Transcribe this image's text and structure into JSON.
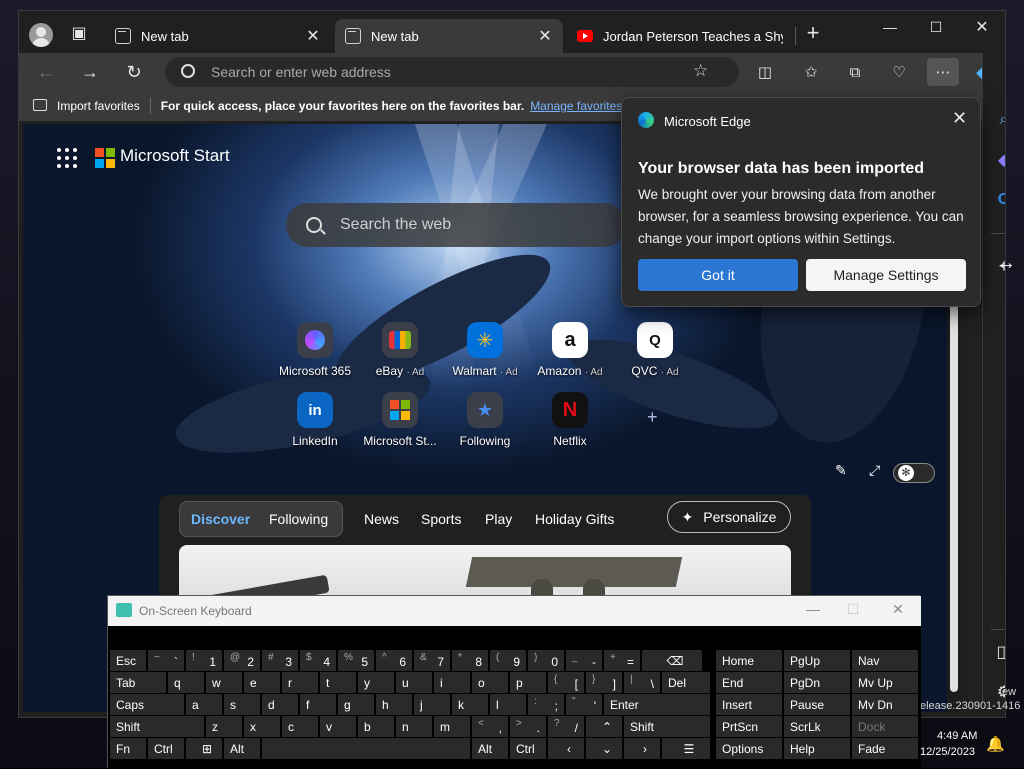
{
  "tabs": [
    {
      "title": "New tab"
    },
    {
      "title": "New tab"
    },
    {
      "title": "Jordan Peterson Teaches a Shy"
    }
  ],
  "address": {
    "placeholder": "Search or enter web address"
  },
  "favorites_bar": {
    "import_label": "Import favorites",
    "hint": "For quick access, place your favorites here on the favorites bar.",
    "manage_link": "Manage favorites"
  },
  "start_page": {
    "brand": "Microsoft Start",
    "search_placeholder": "Search the web",
    "quick_links": [
      {
        "label": "Microsoft 365",
        "ad": "",
        "icon": "microsoft-365-icon",
        "color": "#8a6cff"
      },
      {
        "label": "eBay",
        "ad": "· Ad",
        "icon": "ebay-icon",
        "color": "#e53238"
      },
      {
        "label": "Walmart",
        "ad": "· Ad",
        "icon": "walmart-icon",
        "color": "#0071dc"
      },
      {
        "label": "Amazon",
        "ad": "· Ad",
        "icon": "amazon-icon",
        "color": "#ffffff"
      },
      {
        "label": "QVC",
        "ad": "· Ad",
        "icon": "qvc-icon",
        "color": "#ffffff"
      },
      {
        "label": "LinkedIn",
        "ad": "",
        "icon": "linkedin-icon",
        "color": "#0a66c2"
      },
      {
        "label": "Microsoft St...",
        "ad": "",
        "icon": "microsoft-store-icon",
        "color": "#f25022"
      },
      {
        "label": "Following",
        "ad": "",
        "icon": "following-icon",
        "color": "#3b82f6"
      },
      {
        "label": "Netflix",
        "ad": "",
        "icon": "netflix-icon",
        "color": "#e50914"
      }
    ],
    "feed_tabs": [
      "Discover",
      "Following",
      "News",
      "Sports",
      "Play",
      "Holiday Gifts"
    ],
    "personalize": "Personalize"
  },
  "popup": {
    "app_name": "Microsoft Edge",
    "heading": "Your browser data has been imported",
    "body": "We brought over your browsing data from another browser, for a seamless browsing experience. You can change your import options within Settings.",
    "primary_button": "Got it",
    "secondary_button": "Manage Settings"
  },
  "keyboard": {
    "title": "On-Screen Keyboard",
    "row1": [
      {
        "s": "~",
        "m": "`"
      },
      {
        "s": "!",
        "m": "1"
      },
      {
        "s": "@",
        "m": "2"
      },
      {
        "s": "#",
        "m": "3"
      },
      {
        "s": "$",
        "m": "4"
      },
      {
        "s": "%",
        "m": "5"
      },
      {
        "s": "^",
        "m": "6"
      },
      {
        "s": "&",
        "m": "7"
      },
      {
        "s": "*",
        "m": "8"
      },
      {
        "s": "(",
        "m": "9"
      },
      {
        "s": ")",
        "m": "0"
      },
      {
        "s": "_",
        "m": "-"
      },
      {
        "s": "+",
        "m": "="
      }
    ],
    "row2": [
      "q",
      "w",
      "e",
      "r",
      "t",
      "y",
      "u",
      "i",
      "o",
      "p"
    ],
    "row2_brackets": [
      {
        "s": "{",
        "m": "["
      },
      {
        "s": "}",
        "m": "]"
      },
      {
        "s": "|",
        "m": "\\"
      }
    ],
    "row3": [
      "a",
      "s",
      "d",
      "f",
      "g",
      "h",
      "j",
      "k",
      "l"
    ],
    "row3_punct": [
      {
        "s": ":",
        "m": ";"
      },
      {
        "s": "\"",
        "m": "'"
      }
    ],
    "row4": [
      "z",
      "x",
      "c",
      "v",
      "b",
      "n",
      "m"
    ],
    "row4_punct": [
      {
        "s": "<",
        "m": ","
      },
      {
        "s": ">",
        "m": "."
      },
      {
        "s": "?",
        "m": "/"
      }
    ],
    "labels": {
      "esc": "Esc",
      "tab": "Tab",
      "caps": "Caps",
      "shift": "Shift",
      "fn": "Fn",
      "ctrl": "Ctrl",
      "alt": "Alt",
      "del": "Del",
      "enter": "Enter",
      "rshift": "Shift",
      "ralt": "Alt",
      "rctrl": "Ctrl",
      "home": "Home",
      "pgup": "PgUp",
      "nav": "Nav",
      "end": "End",
      "pgdn": "PgDn",
      "mvup": "Mv Up",
      "insert": "Insert",
      "pause": "Pause",
      "mvdn": "Mv Dn",
      "prtscn": "PrtScn",
      "scrlk": "ScrLk",
      "dock": "Dock",
      "options": "Options",
      "help": "Help",
      "fade": "Fade"
    }
  },
  "desktop": {
    "watermark_1": "ew",
    "watermark_2": "elease.230901-1416",
    "time": "4:49 AM",
    "date": "12/25/2023"
  }
}
